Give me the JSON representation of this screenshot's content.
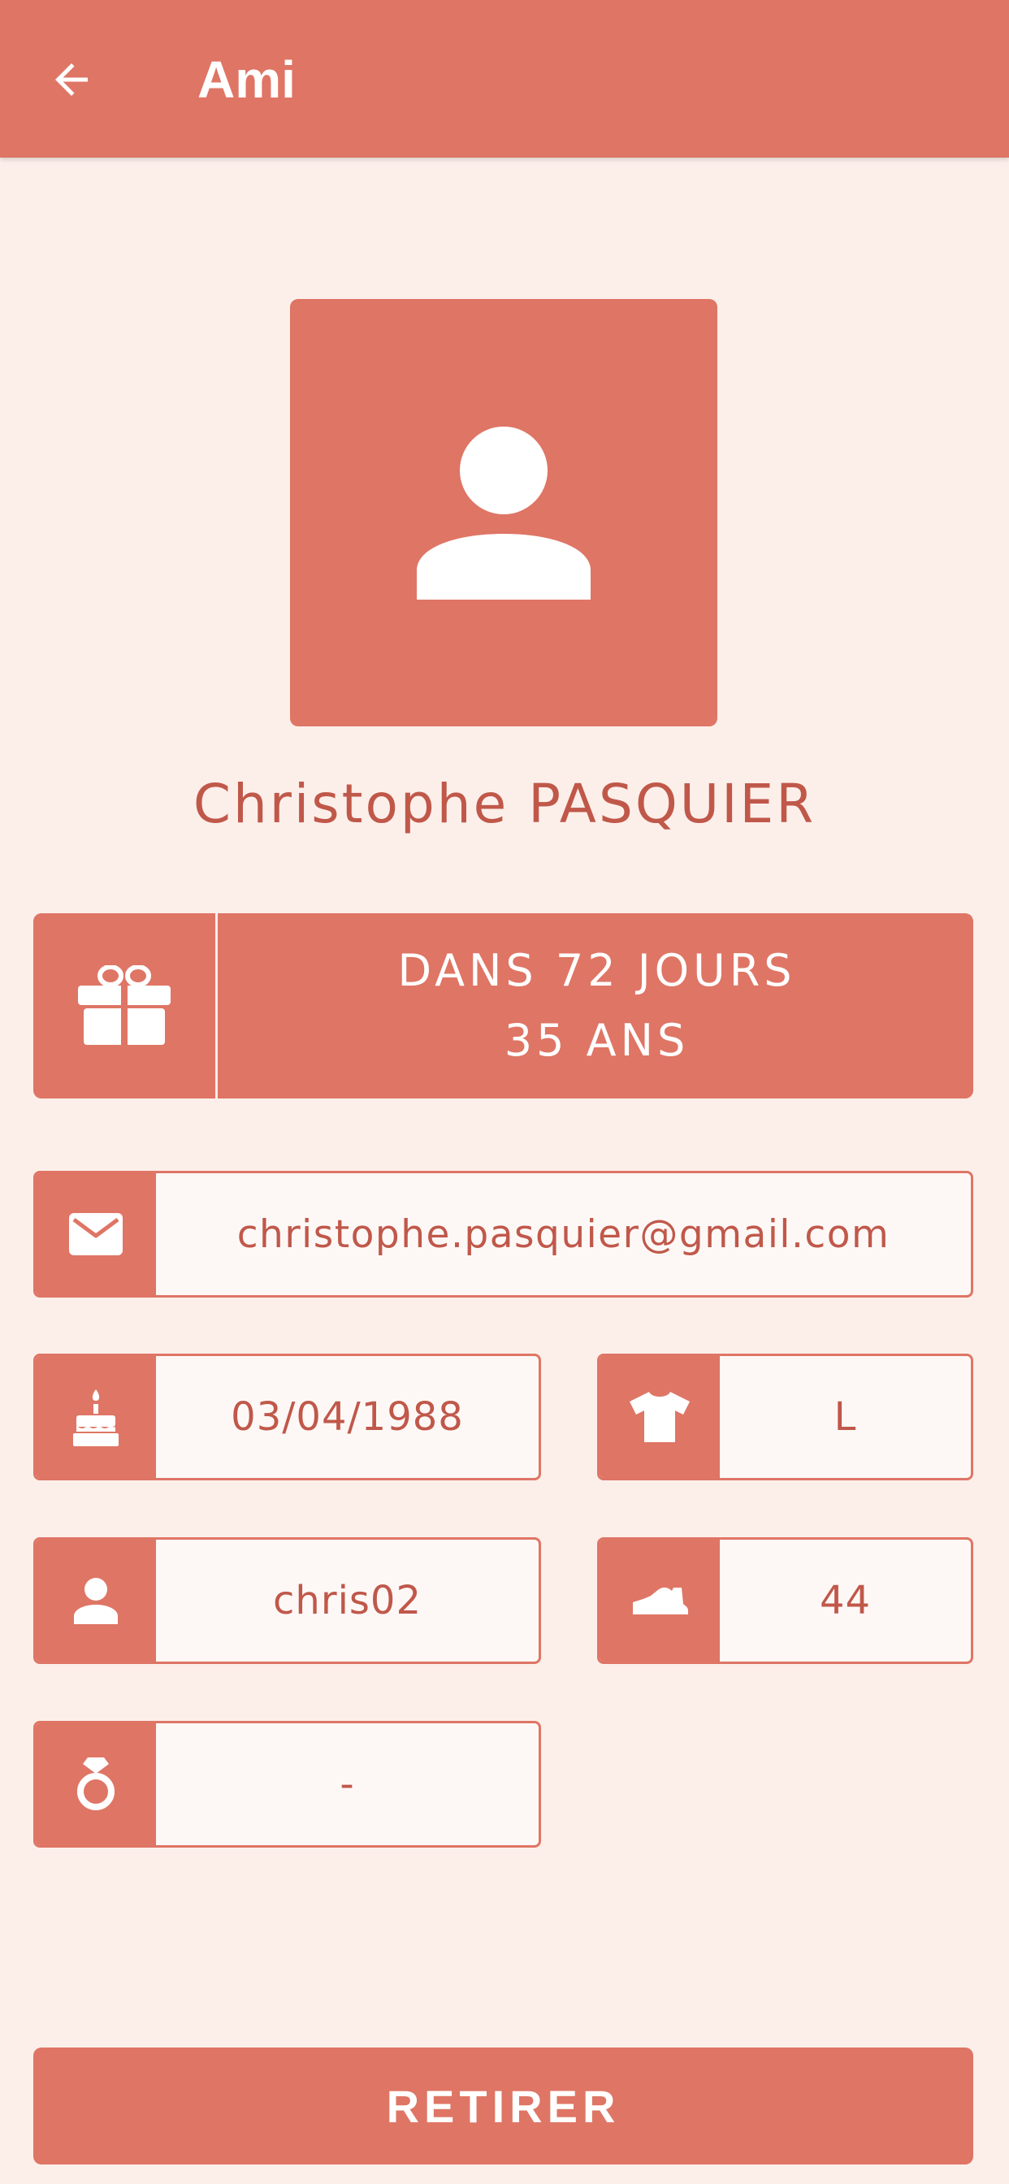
{
  "appbar": {
    "title": "Ami",
    "back_icon": "arrow-left-icon"
  },
  "profile": {
    "avatar_icon": "person-icon",
    "name": "Christophe PASQUIER"
  },
  "birthday": {
    "icon": "gift-icon",
    "countdown": "DANS 72 JOURS",
    "age": "35 ANS"
  },
  "fields": {
    "email": {
      "icon": "mail-icon",
      "value": "christophe.pasquier@gmail.com"
    },
    "birthdate": {
      "icon": "cake-icon",
      "value": "03/04/1988"
    },
    "shirt_size": {
      "icon": "tshirt-icon",
      "value": "L"
    },
    "username": {
      "icon": "user-icon",
      "value": "chris02"
    },
    "shoe_size": {
      "icon": "shoe-icon",
      "value": "44"
    },
    "ring_size": {
      "icon": "ring-icon",
      "value": "-"
    }
  },
  "actions": {
    "remove_label": "RETIRER"
  },
  "colors": {
    "primary": "#df7565",
    "background": "#fcefea",
    "text": "#c0584a",
    "field_background": "#fdf8f6"
  }
}
